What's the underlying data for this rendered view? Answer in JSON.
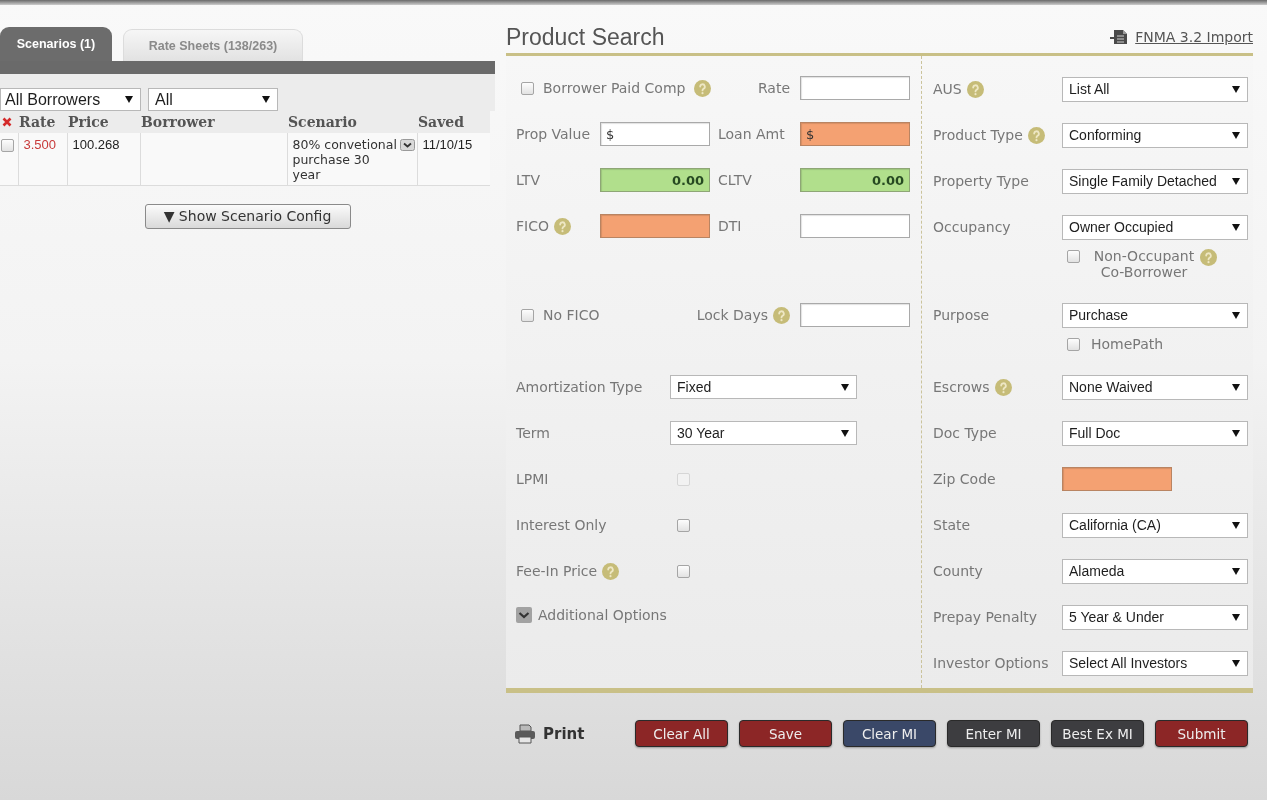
{
  "tabs": [
    {
      "label": "Scenarios (1)",
      "selected": true
    },
    {
      "label": "Rate Sheets (138/263)",
      "selected": false
    }
  ],
  "scenario_list": {
    "filters": [
      {
        "value": "All Borrowers"
      },
      {
        "value": "All"
      }
    ],
    "columns": [
      "Rate",
      "Price",
      "Borrower",
      "Scenario",
      "Saved"
    ],
    "rows": [
      {
        "checked": false,
        "rate": "3.500",
        "price": "100.268",
        "scenario": "80% convetional purchase 30 year",
        "saved": "11/10/15"
      }
    ],
    "config_button": "▼ Show Scenario Config"
  },
  "product_search": {
    "title": "Product Search",
    "import_link": "FNMA 3.2 Import",
    "top_rows": [
      [
        {
          "kind": "checkbox",
          "label": "Borrower Paid Comp",
          "checked": false,
          "help": true
        },
        {
          "kind": "input",
          "label": "Rate",
          "error": false,
          "computed": false
        }
      ],
      [
        {
          "kind": "input",
          "label": "Prop Value",
          "value": "$",
          "error": false,
          "computed": false
        },
        {
          "kind": "input",
          "label": "Loan Amt",
          "value": "$",
          "error": true,
          "computed": false
        }
      ],
      [
        {
          "kind": "input",
          "label": "LTV",
          "value": "0.00",
          "error": false,
          "computed": true
        },
        {
          "kind": "input",
          "label": "CLTV",
          "value": "0.00",
          "error": false,
          "computed": true
        }
      ],
      [
        {
          "kind": "input",
          "label": "FICO",
          "help": true,
          "error": true,
          "computed": false
        },
        {
          "kind": "input",
          "label": "DTI",
          "error": false,
          "computed": false
        }
      ]
    ],
    "lock_row": [
      {
        "kind": "checkbox",
        "label": "No FICO",
        "checked": false
      },
      {
        "kind": "input",
        "label": "Lock Days",
        "help": true,
        "error": false,
        "computed": false
      }
    ],
    "options": [
      {
        "kind": "select",
        "label": "Amortization Type",
        "value": "Fixed"
      },
      {
        "kind": "select",
        "label": "Term",
        "value": "30 Year"
      },
      {
        "kind": "checkbox",
        "label": "LPMI",
        "checked": false,
        "disabled": true
      },
      {
        "kind": "checkbox",
        "label": "Interest Only",
        "checked": false,
        "disabled": false
      },
      {
        "kind": "checkbox",
        "label": "Fee-In Price",
        "checked": false,
        "disabled": false,
        "help": true
      }
    ],
    "additional_options": {
      "label": "Additional Options",
      "expanded": false
    },
    "criteria": [
      {
        "kind": "select",
        "label": "AUS",
        "help": true,
        "value": "List All"
      },
      {
        "kind": "select",
        "label": "Product Type",
        "help": true,
        "value": "Conforming"
      },
      {
        "kind": "select",
        "label": "Property Type",
        "value": "Single Family Detached"
      },
      {
        "kind": "select",
        "label": "Occupancy",
        "value": "Owner Occupied",
        "sub": {
          "label": "Non-Occupant Co-Borrower",
          "checked": false,
          "help": true
        }
      },
      {
        "kind": "select",
        "label": "Purpose",
        "value": "Purchase",
        "sub": {
          "label": "HomePath",
          "checked": false
        }
      },
      {
        "kind": "select",
        "label": "Escrows",
        "help": true,
        "value": "None Waived"
      },
      {
        "kind": "select",
        "label": "Doc Type",
        "value": "Full Doc"
      },
      {
        "kind": "input",
        "label": "Zip Code",
        "error": true,
        "computed": false
      },
      {
        "kind": "select",
        "label": "State",
        "value": "California (CA)"
      },
      {
        "kind": "select",
        "label": "County",
        "value": "Alameda"
      },
      {
        "kind": "select",
        "label": "Prepay Penalty",
        "value": "5 Year & Under"
      },
      {
        "kind": "select",
        "label": "Investor Options",
        "value": "Select All Investors"
      }
    ],
    "print": "Print",
    "actions": [
      {
        "label": "Clear All",
        "color": "#8c2626"
      },
      {
        "label": "Save",
        "color": "#8c2626"
      },
      {
        "label": "Clear MI",
        "color": "#3a4868"
      },
      {
        "label": "Enter MI",
        "color": "#3d3d40"
      },
      {
        "label": "Best Ex MI",
        "color": "#3d3d40"
      },
      {
        "label": "Submit",
        "color": "#8c2626"
      }
    ]
  }
}
